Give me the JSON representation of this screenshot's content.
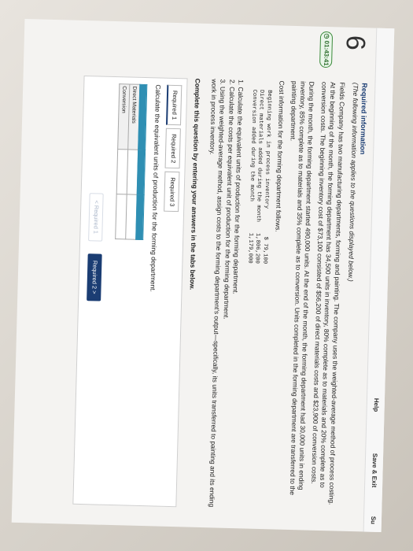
{
  "header": {
    "help": "Help",
    "save_exit": "Save & Exit",
    "submit": "Su"
  },
  "question_number": "6",
  "timer": "01:43:41",
  "required_info": {
    "title": "Required information",
    "subtitle": "(The following information applies to the questions displayed below.)"
  },
  "paragraphs": [
    "Fields Company has two manufacturing departments, forming and painting. The company uses the weighted-average method of process costing. At the beginning of the month, the forming department has 34,500 units in inventory, 80% complete as to materials and 20% complete as to conversion costs. The beginning inventory cost of $73,100 consisted of $56,200 of direct materials costs and $23,900 of conversion costs.",
    "During the month, the forming department started 490,000 units. At the end of the month, the forming department had 30,000 units in ending inventory, 85% complete as to materials and 35% complete as to conversion. Units completed in the forming department are transferred to the painting department.",
    "Cost information for the forming department follows."
  ],
  "cost_table": [
    {
      "label": "Beginning work in process inventory",
      "value": "$   79,100"
    },
    {
      "label": "Direct materials added during the month",
      "value": "1,806,200"
    },
    {
      "label": "Conversion added during the month",
      "value": "1,179,000"
    }
  ],
  "instructions": [
    "1. Calculate the equivalent units of production for the forming department.",
    "2. Calculate the costs per equivalent unit of production for the forming department.",
    "3. Using the weighted-average method, assign costs to the forming department's output—specifically, its units transferred to painting and its ending work in process inventory."
  ],
  "complete_prompt": "Complete this question by entering your answers in the tabs below.",
  "tabs": [
    "Required 1",
    "Required 2",
    "Required 3"
  ],
  "calc_prompt": "Calculate the equivalent units of production for the forming department.",
  "answer_rows": [
    "Direct Materials",
    "Conversion"
  ],
  "nav": {
    "prev": "<  Required 1",
    "next": "Required 2  >"
  },
  "colors": {
    "accent": "#1b3d73",
    "table_header": "#2f8fb3",
    "timer": "#3a8a3a"
  }
}
